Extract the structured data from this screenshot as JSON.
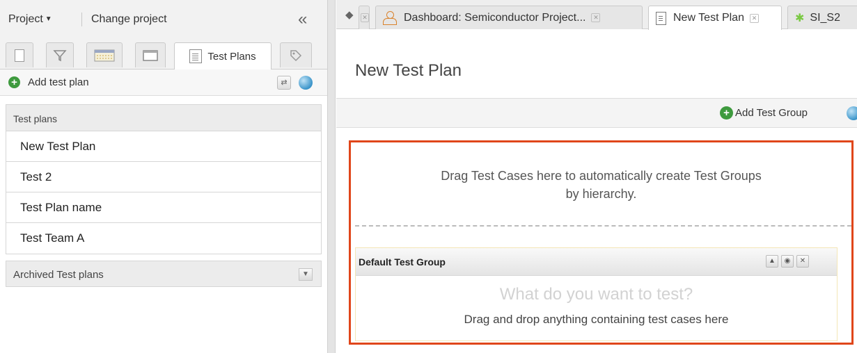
{
  "left_panel": {
    "project_label": "Project",
    "change_project_label": "Change project",
    "collapse_glyph": "«",
    "tabs": [
      {
        "icon": "list-view-icon",
        "label": ""
      },
      {
        "icon": "filter-icon",
        "label": ""
      },
      {
        "icon": "calendar-icon",
        "label": ""
      },
      {
        "icon": "window-icon",
        "label": ""
      },
      {
        "icon": "test-plans-icon",
        "label": "Test Plans"
      },
      {
        "icon": "tag-icon",
        "label": ""
      }
    ],
    "add_test_plan_label": "Add test plan",
    "test_plans_header": "Test plans",
    "test_plans": [
      "New Test Plan",
      "Test 2",
      "Test Plan name",
      "Test Team A"
    ],
    "archived_label": "Archived Test plans"
  },
  "right_panel": {
    "tabs": [
      {
        "label": "Dashboard: Semiconductor Project...",
        "icon": "people-icon"
      },
      {
        "label": "New Test Plan",
        "icon": "document-icon",
        "active": true
      },
      {
        "label": "SI_S2",
        "icon": "star-icon"
      }
    ],
    "page_title": "New Test Plan",
    "add_test_group_label": "Add Test Group",
    "drag_message_line1": "Drag Test Cases here to automatically create Test Groups",
    "drag_message_line2": "by hierarchy.",
    "group": {
      "title": "Default Test Group",
      "placeholder": "What do you want to test?",
      "drop_text": "Drag and drop anything containing test cases here"
    }
  },
  "colors": {
    "accent_border": "#e0461a",
    "add_button_green": "#3e9a3e",
    "dashboard_icon": "#d9822b"
  }
}
